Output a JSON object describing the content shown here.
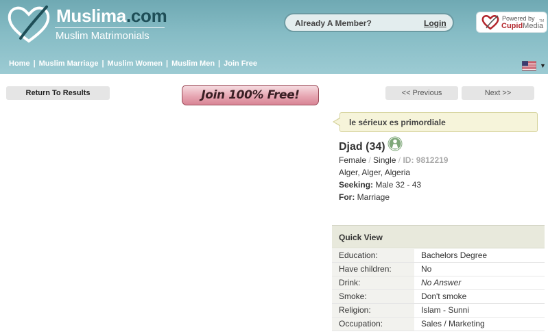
{
  "header": {
    "logo_name": "Muslima",
    "logo_domain": ".com",
    "logo_subtitle": "Muslim Matrimonials",
    "member_prompt": "Already A Member?",
    "login_label": "Login",
    "powered_by": "Powered by",
    "cupid_name": "Cupid",
    "cupid_media": "Media",
    "cupid_tm": "TM",
    "flag_dropdown_arrow": "▼",
    "nav": [
      "Home",
      "Muslim Marriage",
      "Muslim Women",
      "Muslim Men",
      "Join Free"
    ],
    "nav_separator": "|"
  },
  "actions": {
    "return_label": "Return To Results",
    "join_label": "Join 100% Free!",
    "previous_label": "<< Previous",
    "next_label": "Next >>"
  },
  "profile": {
    "tagline": "le sérieux es primordiale",
    "name_age": "Djad (34)",
    "gender": "Female",
    "marital_status": "Single",
    "separator": "/",
    "id_label": "ID: 9812219",
    "location": "Alger, Alger, Algeria",
    "seeking_label": "Seeking:",
    "seeking_value": "Male 32 - 43",
    "for_label": "For:",
    "for_value": "Marriage"
  },
  "quick_view": {
    "title": "Quick View",
    "rows": [
      {
        "label": "Education:",
        "value": "Bachelors Degree"
      },
      {
        "label": "Have children:",
        "value": "No"
      },
      {
        "label": "Drink:",
        "value": "No Answer"
      },
      {
        "label": "Smoke:",
        "value": "Don't smoke"
      },
      {
        "label": "Religion:",
        "value": "Islam - Sunni"
      },
      {
        "label": "Occupation:",
        "value": "Sales / Marketing"
      }
    ]
  },
  "colors": {
    "header_teal": "#86bcc5",
    "join_pink": "#e7a7b3",
    "tagline_bg": "#f6f4da",
    "cupid_red": "#b3262c"
  },
  "icons": {
    "logo": "heart-logo-icon",
    "cupid": "cupid-heart-icon",
    "flag": "us-flag-icon",
    "avatar": "female-avatar-icon"
  }
}
